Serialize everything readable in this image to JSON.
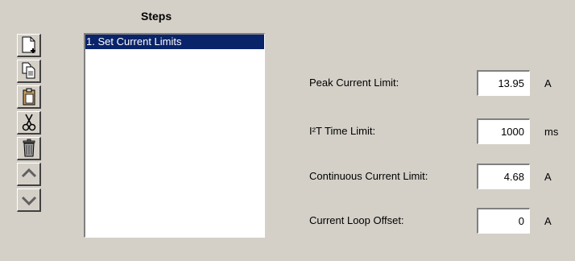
{
  "steps": {
    "title": "Steps",
    "items": [
      {
        "label": "1. Set Current Limits",
        "selected": true
      }
    ]
  },
  "toolbar": {
    "buttons": [
      {
        "icon": "new-step-icon"
      },
      {
        "icon": "copy-icon"
      },
      {
        "icon": "paste-icon"
      },
      {
        "icon": "cut-icon"
      },
      {
        "icon": "delete-icon"
      },
      {
        "icon": "move-up-icon"
      },
      {
        "icon": "move-down-icon"
      }
    ]
  },
  "params": [
    {
      "label": "Peak Current Limit:",
      "value": "13.95",
      "unit": "A"
    },
    {
      "label": "I²T Time Limit:",
      "value": "1000",
      "unit": "ms"
    },
    {
      "label": "Continuous Current Limit:",
      "value": "4.68",
      "unit": "A"
    },
    {
      "label": "Current Loop Offset:",
      "value": "0",
      "unit": "A"
    }
  ],
  "colors": {
    "background": "#d4d0c8",
    "selection": "#0a246a",
    "selection_text": "#ffffff"
  }
}
